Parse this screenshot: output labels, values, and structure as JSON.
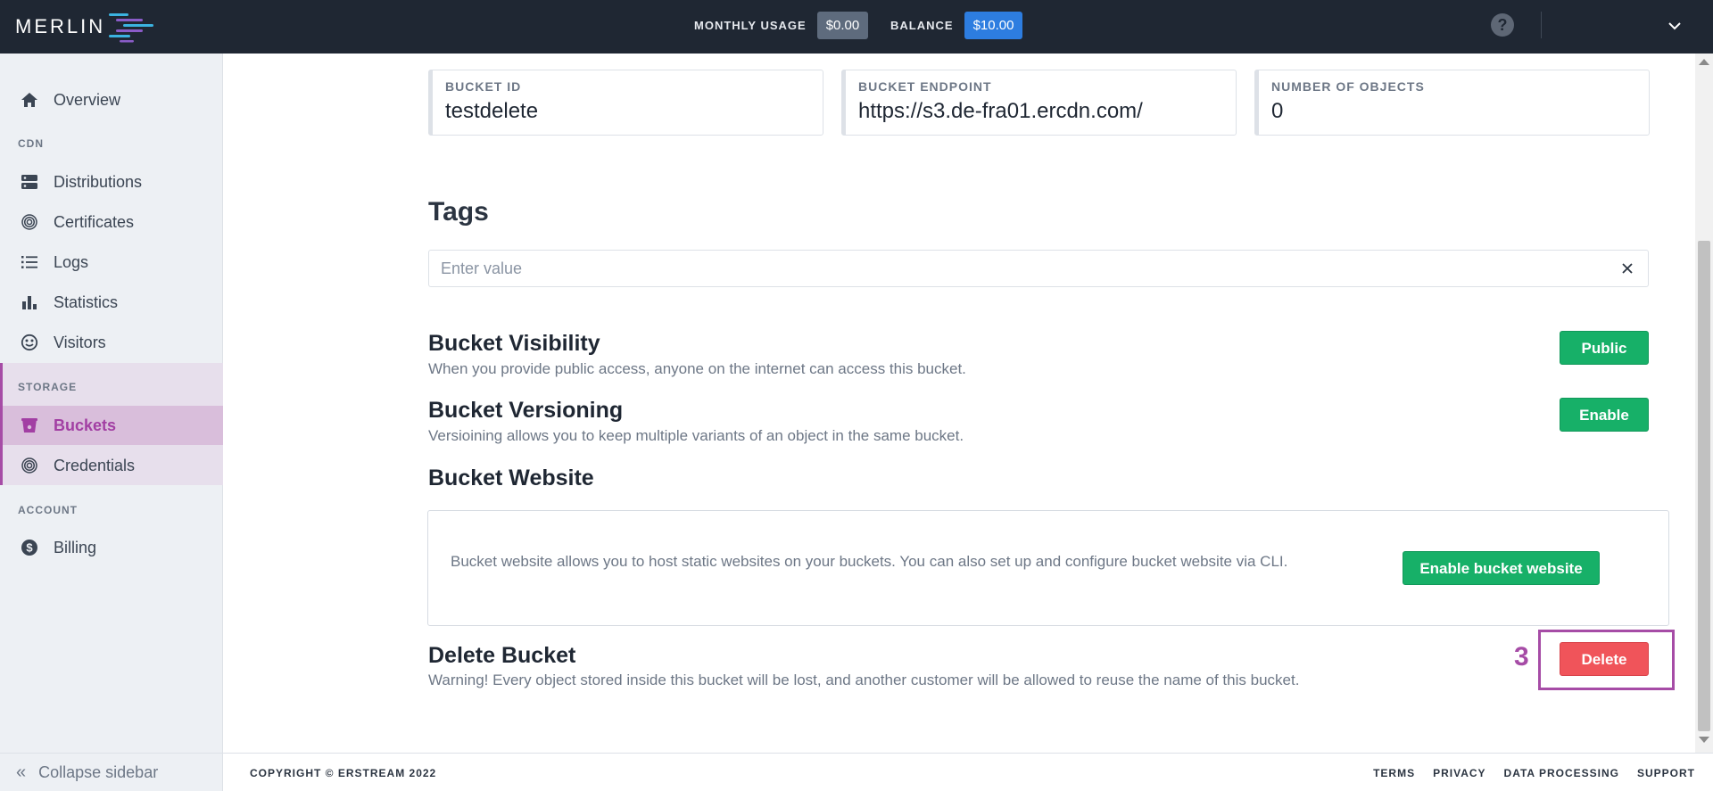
{
  "header": {
    "logo_text": "MERLIN",
    "monthly_usage_label": "MONTHLY USAGE",
    "monthly_usage_value": "$0.00",
    "balance_label": "BALANCE",
    "balance_value": "$10.00",
    "help_icon": "?"
  },
  "sidebar": {
    "items": [
      {
        "label": "Overview",
        "icon": "home-icon"
      },
      {
        "label": "Distributions",
        "icon": "server-icon"
      },
      {
        "label": "Certificates",
        "icon": "fingerprint-icon"
      },
      {
        "label": "Logs",
        "icon": "list-icon"
      },
      {
        "label": "Statistics",
        "icon": "bar-chart-icon"
      },
      {
        "label": "Visitors",
        "icon": "smiley-icon"
      },
      {
        "label": "Buckets",
        "icon": "bucket-icon"
      },
      {
        "label": "Credentials",
        "icon": "fingerprint-icon"
      },
      {
        "label": "Billing",
        "icon": "dollar-icon"
      }
    ],
    "sections": {
      "cdn": "CDN",
      "storage": "STORAGE",
      "account": "ACCOUNT"
    },
    "active_item": "Buckets",
    "collapse_label": "Collapse sidebar"
  },
  "bucket": {
    "id_label": "BUCKET ID",
    "id_value": "testdelete",
    "endpoint_label": "BUCKET ENDPOINT",
    "endpoint_value": "https://s3.de-fra01.ercdn.com/",
    "objects_label": "NUMBER OF OBJECTS",
    "objects_value": "0"
  },
  "tags": {
    "title": "Tags",
    "placeholder": "Enter value"
  },
  "visibility": {
    "title": "Bucket Visibility",
    "description": "When you provide public access, anyone on the internet can access this bucket.",
    "button": "Public"
  },
  "versioning": {
    "title": "Bucket Versioning",
    "description": "Versioining allows you to keep multiple variants of an object in the same bucket.",
    "button": "Enable"
  },
  "website": {
    "title": "Bucket Website",
    "description": "Bucket website allows you to host static websites on your buckets. You can also set up and configure bucket website via CLI.",
    "button": "Enable bucket website"
  },
  "delete": {
    "title": "Delete Bucket",
    "description": "Warning! Every object stored inside this bucket will be lost, and another customer will be allowed to reuse the name of this bucket.",
    "button": "Delete",
    "step_number": "3"
  },
  "footer": {
    "copyright": "COPYRIGHT © ERSTREAM 2022",
    "links": [
      "TERMS",
      "PRIVACY",
      "DATA PROCESSING",
      "SUPPORT"
    ]
  },
  "colors": {
    "topbar": "#1f2733",
    "accent_purple": "#a64ca6",
    "green": "#17b068",
    "red": "#f0545a",
    "blue": "#2d7de0"
  }
}
